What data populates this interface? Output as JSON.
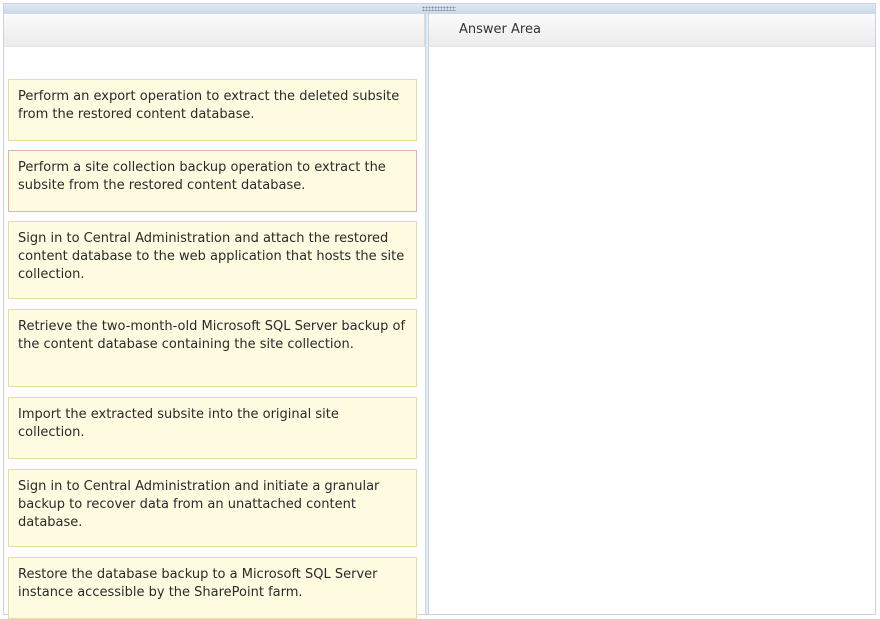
{
  "answer_area": {
    "title": "Answer Area"
  },
  "steps": [
    {
      "text": "Perform an export operation to extract the deleted subsite from the restored content database."
    },
    {
      "text": "Perform a site collection backup operation to extract the subsite from the restored content database."
    },
    {
      "text": "Sign in to Central Administration and attach the restored content database to the web application that hosts the site collection."
    },
    {
      "text": "Retrieve the two-month-old Microsoft SQL Server backup of the content database containing the site collection."
    },
    {
      "text": "Import the extracted subsite into the original site collection."
    },
    {
      "text": "Sign in to Central Administration and initiate a granular backup to recover data from an unattached content database."
    },
    {
      "text": "Restore the database backup to a Microsoft SQL Server instance accessible by the SharePoint farm."
    }
  ]
}
